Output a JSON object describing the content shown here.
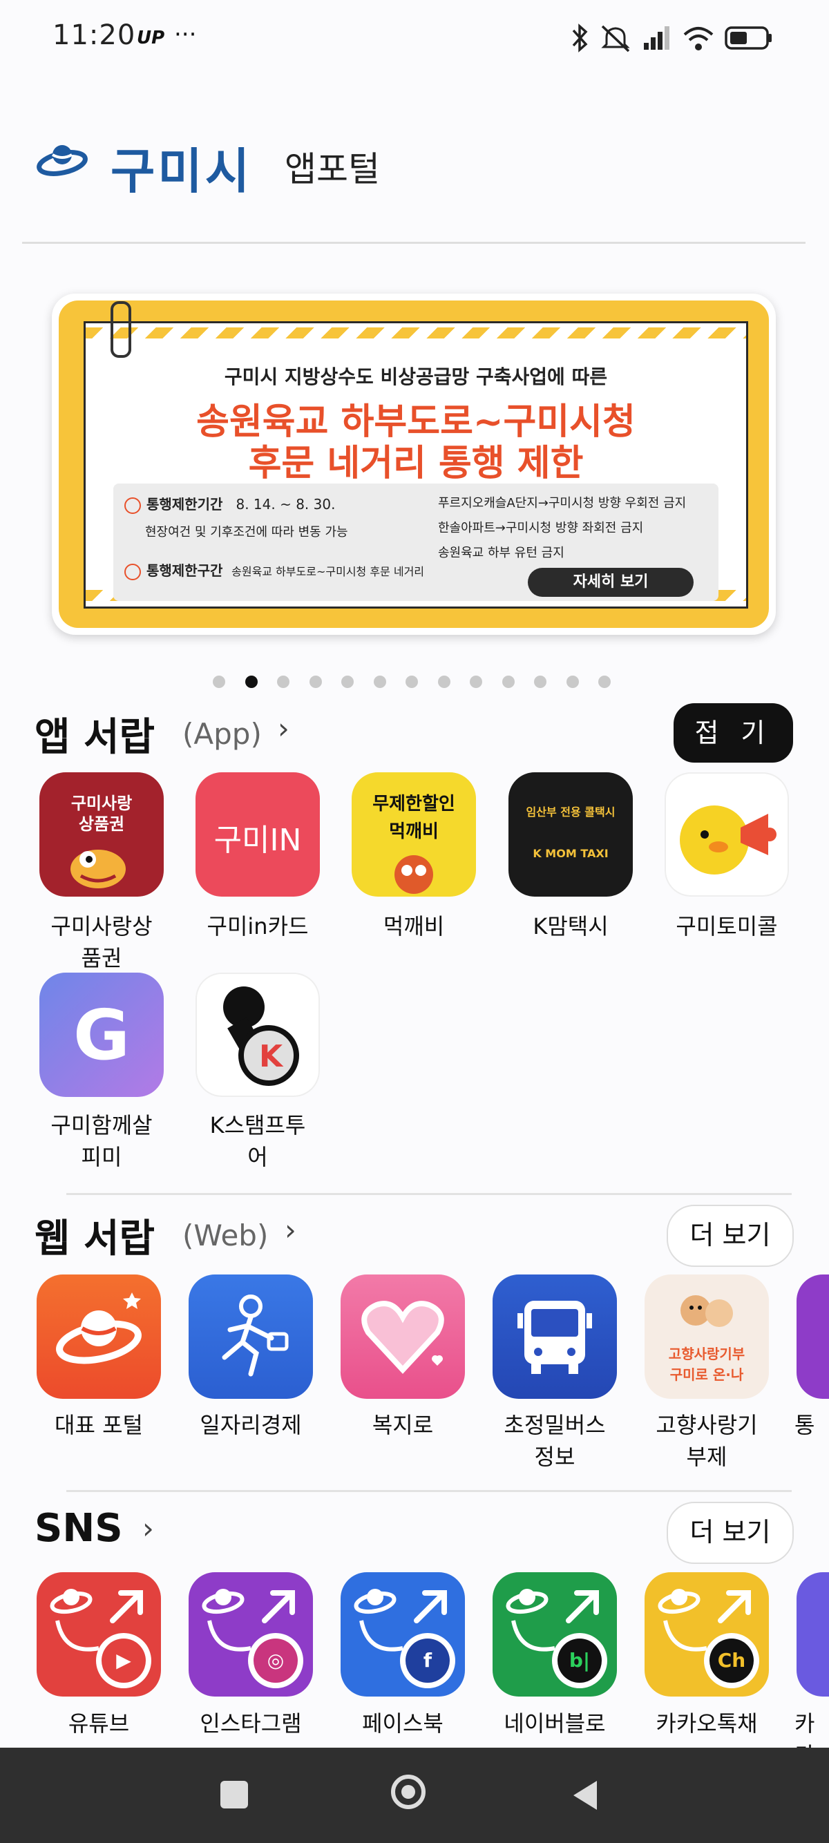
{
  "status_bar": {
    "time": "11:20",
    "carrier_badge": "UP",
    "more": "···",
    "icons": [
      "bluetooth-icon",
      "mute-icon",
      "signal-icon",
      "wifi-icon",
      "battery-icon"
    ]
  },
  "header": {
    "title": "구미시",
    "subtitle": "앱포털"
  },
  "banner": {
    "line1": "구미시 지방상수도 비상공급망 구축사업에 따른",
    "line2": "송원육교 하부도로~구미시청",
    "line3": "후문 네거리 통행 제한",
    "period_label": "통행제한기간",
    "period_value": "8. 14. ~ 8. 30.",
    "period_note": "현장여건 및 기후조건에 따라 변동 가능",
    "section_label": "통행제한구간",
    "section_value": "송원육교 하부도로~구미시청 후문 네거리",
    "right1": "푸르지오캐슬A단지→구미시청 방향 우회전 금지",
    "right2": "한솔아파트→구미시청 방향 좌회전 금지",
    "right3": "송원육교 하부 유턴 금지",
    "button": "자세히 보기",
    "page_count": 13,
    "active_page": 2
  },
  "app_section": {
    "title": "앱 서랍",
    "sub": "(App)",
    "chevron": "›",
    "button": "접 기",
    "apps": [
      {
        "label": "구미사랑상\n품권",
        "icon_text": "구미사랑\n상품권"
      },
      {
        "label": "구미in카드",
        "icon_text": "구미IN"
      },
      {
        "label": "먹깨비",
        "icon_text": "무제한할인\n먹깨비"
      },
      {
        "label": "K맘택시",
        "icon_text": "임산부 전용 콜택시\nK MOM TAXI"
      },
      {
        "label": "구미토미콜",
        "icon_text": ""
      },
      {
        "label": "구미함께살\n피미",
        "icon_text": "G"
      },
      {
        "label": "K스탬프투\n어",
        "icon_text": "K"
      }
    ]
  },
  "web_section": {
    "title": "웹 서랍",
    "sub": "(Web)",
    "chevron": "›",
    "button": "더 보기",
    "items": [
      {
        "label": "대표 포털"
      },
      {
        "label": "일자리경제"
      },
      {
        "label": "복지로"
      },
      {
        "label": "초정밀버스\n정보"
      },
      {
        "label": "고향사랑기\n부제",
        "icon_text": "고향사랑기부\n구미로 온·나"
      },
      {
        "label": "통"
      }
    ]
  },
  "sns_section": {
    "title": "SNS",
    "chevron": "›",
    "button": "더 보기",
    "items": [
      {
        "label": "유튜브",
        "color": "#e2413e",
        "badge": "▶"
      },
      {
        "label": "인스타그램",
        "color": "#8e3cc8",
        "badge": "◎"
      },
      {
        "label": "페이스북",
        "color": "#2f6fe0",
        "badge": "f"
      },
      {
        "label": "네이버블로",
        "color": "#1f9d4a",
        "badge": "b|"
      },
      {
        "label": "카카오톡채",
        "color": "#f2c02a",
        "badge": "Ch"
      },
      {
        "label": "카카",
        "color": "#6a5ae0",
        "badge": ""
      }
    ]
  },
  "nav": {
    "items": [
      "recents-icon",
      "home-icon",
      "back-icon"
    ]
  }
}
